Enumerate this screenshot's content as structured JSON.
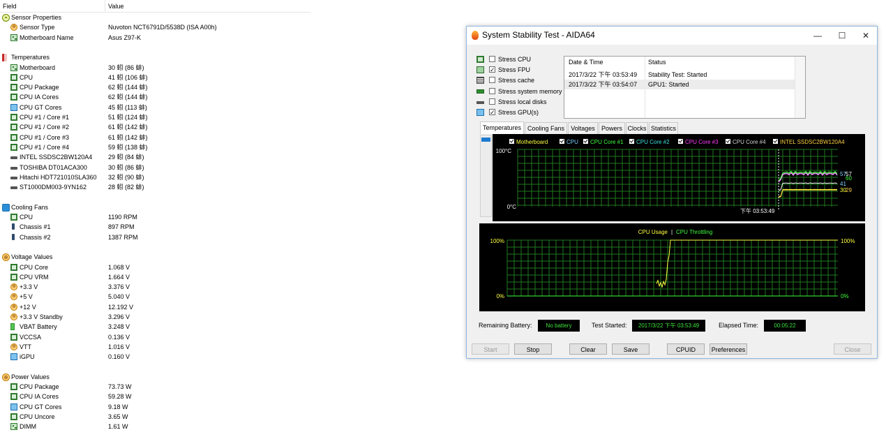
{
  "sensor_list": {
    "header": {
      "field": "Field",
      "value": "Value"
    },
    "rows": [
      {
        "kind": "section",
        "icon": "sensor-icon",
        "label": "Sensor Properties",
        "value": ""
      },
      {
        "kind": "item",
        "icon": "sensor-icon",
        "label": "Sensor Type",
        "value": "Nuvoton NCT6791D/5538D  (ISA A00h)"
      },
      {
        "kind": "item",
        "icon": "motherboard-icon",
        "label": "Motherboard Name",
        "value": "Asus Z97-K"
      },
      {
        "kind": "gap"
      },
      {
        "kind": "section",
        "icon": "thermometer-icon",
        "label": "Temperatures",
        "value": ""
      },
      {
        "kind": "item",
        "icon": "motherboard-icon",
        "label": "Motherboard",
        "value": "30 蚓  (86 蚌)"
      },
      {
        "kind": "item",
        "icon": "cpu-icon",
        "label": "CPU",
        "value": "41 蚓  (106 蚌)"
      },
      {
        "kind": "item",
        "icon": "cpu-icon",
        "label": "CPU Package",
        "value": "62 蚓  (144 蚌)"
      },
      {
        "kind": "item",
        "icon": "cpu-icon",
        "label": "CPU IA Cores",
        "value": "62 蚓  (144 蚌)"
      },
      {
        "kind": "item",
        "icon": "gpu-icon",
        "label": "CPU GT Cores",
        "value": "45 蚓  (113 蚌)"
      },
      {
        "kind": "item",
        "icon": "cpu-icon",
        "label": "CPU #1 / Core #1",
        "value": "51 蚓  (124 蚌)"
      },
      {
        "kind": "item",
        "icon": "cpu-icon",
        "label": "CPU #1 / Core #2",
        "value": "61 蚓  (142 蚌)"
      },
      {
        "kind": "item",
        "icon": "cpu-icon",
        "label": "CPU #1 / Core #3",
        "value": "61 蚓  (142 蚌)"
      },
      {
        "kind": "item",
        "icon": "cpu-icon",
        "label": "CPU #1 / Core #4",
        "value": "59 蚓  (138 蚌)"
      },
      {
        "kind": "item",
        "icon": "disk-icon",
        "label": "INTEL SSDSC2BW120A4",
        "value": "29 蚓  (84 蚌)"
      },
      {
        "kind": "item",
        "icon": "disk-icon",
        "label": "TOSHIBA DT01ACA300",
        "value": "30 蚓  (86 蚌)"
      },
      {
        "kind": "item",
        "icon": "disk-icon",
        "label": "Hitachi HDT721010SLA360",
        "value": "32 蚓  (90 蚌)"
      },
      {
        "kind": "item",
        "icon": "disk-icon",
        "label": "ST1000DM003-9YN162",
        "value": "28 蚓  (82 蚌)"
      },
      {
        "kind": "gap"
      },
      {
        "kind": "section",
        "icon": "fan-icon",
        "label": "Cooling Fans",
        "value": ""
      },
      {
        "kind": "item",
        "icon": "cpu-icon",
        "label": "CPU",
        "value": "1190 RPM"
      },
      {
        "kind": "item",
        "icon": "chassis-icon",
        "label": "Chassis #1",
        "value": "897 RPM"
      },
      {
        "kind": "item",
        "icon": "chassis-icon",
        "label": "Chassis #2",
        "value": "1387 RPM"
      },
      {
        "kind": "gap"
      },
      {
        "kind": "section",
        "icon": "voltage-icon",
        "label": "Voltage Values",
        "value": ""
      },
      {
        "kind": "item",
        "icon": "cpu-icon",
        "label": "CPU Core",
        "value": "1.068 V"
      },
      {
        "kind": "item",
        "icon": "cpu-icon",
        "label": "CPU VRM",
        "value": "1.664 V"
      },
      {
        "kind": "item",
        "icon": "voltage-icon",
        "label": "+3.3 V",
        "value": "3.376 V"
      },
      {
        "kind": "item",
        "icon": "voltage-icon",
        "label": "+5 V",
        "value": "5.040 V"
      },
      {
        "kind": "item",
        "icon": "voltage-icon",
        "label": "+12 V",
        "value": "12.192 V"
      },
      {
        "kind": "item",
        "icon": "voltage-icon",
        "label": "+3.3 V Standby",
        "value": "3.296 V"
      },
      {
        "kind": "item",
        "icon": "battery-icon",
        "label": "VBAT Battery",
        "value": "3.248 V"
      },
      {
        "kind": "item",
        "icon": "cpu-icon",
        "label": "VCCSA",
        "value": "0.136 V"
      },
      {
        "kind": "item",
        "icon": "voltage-icon",
        "label": "VTT",
        "value": "1.016 V"
      },
      {
        "kind": "item",
        "icon": "gpu-icon",
        "label": "iGPU",
        "value": "0.160 V"
      },
      {
        "kind": "gap"
      },
      {
        "kind": "section",
        "icon": "voltage-icon",
        "label": "Power Values",
        "value": ""
      },
      {
        "kind": "item",
        "icon": "cpu-icon",
        "label": "CPU Package",
        "value": "73.73 W"
      },
      {
        "kind": "item",
        "icon": "cpu-icon",
        "label": "CPU IA Cores",
        "value": "59.28 W"
      },
      {
        "kind": "item",
        "icon": "gpu-icon",
        "label": "CPU GT Cores",
        "value": "9.18 W"
      },
      {
        "kind": "item",
        "icon": "cpu-icon",
        "label": "CPU Uncore",
        "value": "3.65 W"
      },
      {
        "kind": "item",
        "icon": "dimm-icon",
        "label": "DIMM",
        "value": "1.61 W"
      }
    ]
  },
  "window": {
    "title": "System Stability Test - AIDA64",
    "controls": {
      "minimize": "—",
      "maximize": "☐",
      "close": "✕"
    },
    "stress_options": [
      {
        "label": "Stress CPU",
        "checked": false,
        "icon": "cpu-icon"
      },
      {
        "label": "Stress FPU",
        "checked": true,
        "icon": "fpu-icon"
      },
      {
        "label": "Stress cache",
        "checked": false,
        "icon": "cache-icon"
      },
      {
        "label": "Stress system memory",
        "checked": false,
        "icon": "memory-icon"
      },
      {
        "label": "Stress local disks",
        "checked": false,
        "icon": "disk-icon"
      },
      {
        "label": "Stress GPU(s)",
        "checked": true,
        "icon": "monitor-icon"
      }
    ],
    "log": {
      "col_date": "Date & Time",
      "col_status": "Status",
      "rows": [
        {
          "date": "2017/3/22 下午 03:53:49",
          "status": "Stability Test: Started"
        },
        {
          "date": "2017/3/22 下午 03:54:07",
          "status": "GPU1: Started"
        }
      ]
    },
    "tabs": [
      "Temperatures",
      "Cooling Fans",
      "Voltages",
      "Powers",
      "Clocks",
      "Statistics"
    ],
    "temp_graph": {
      "legend": [
        {
          "label": "Motherboard",
          "color": "#ffff40"
        },
        {
          "label": "CPU",
          "color": "#7fd0ff"
        },
        {
          "label": "CPU Core #1",
          "color": "#40ff40"
        },
        {
          "label": "CPU Core #2",
          "color": "#40e0e0"
        },
        {
          "label": "CPU Core #3",
          "color": "#ff40ff"
        },
        {
          "label": "CPU Core #4",
          "color": "#d0d0d0"
        },
        {
          "label": "INTEL SSDSC2BW120A4",
          "color": "#ffd040"
        }
      ],
      "y_max_label": "100°C",
      "y_min_label": "0°C",
      "time_label": "下午 03:53:49",
      "right_labels": [
        {
          "text": "57",
          "color": "#7fd0ff",
          "value": 57
        },
        {
          "text": "57",
          "color": "#ffffff",
          "value": 57
        },
        {
          "text": "60",
          "color": "#40ff40",
          "value": 60
        },
        {
          "text": "41",
          "color": "#7fd0ff",
          "value": 41
        },
        {
          "text": "30",
          "color": "#ffff40",
          "value": 30
        },
        {
          "text": "29",
          "color": "#ffd040",
          "value": 29
        }
      ]
    },
    "cpu_graph": {
      "title_usage": "CPU Usage",
      "title_sep": "|",
      "title_throttling": "CPU Throttling",
      "usage_color": "#ffff40",
      "throttling_color": "#40ff40",
      "left_top": "100%",
      "left_bottom": "0%",
      "right_top": "100%",
      "right_bottom": "0%"
    },
    "status": {
      "battery_label": "Remaining Battery:",
      "battery_value": "No battery",
      "started_label": "Test Started:",
      "started_value": "2017/3/22 下午 03:53:49",
      "elapsed_label": "Elapsed Time:",
      "elapsed_value": "00:05:22"
    },
    "buttons": {
      "start": "Start",
      "stop": "Stop",
      "clear": "Clear",
      "save": "Save",
      "cpuid": "CPUID",
      "preferences": "Preferences",
      "close": "Close"
    }
  }
}
